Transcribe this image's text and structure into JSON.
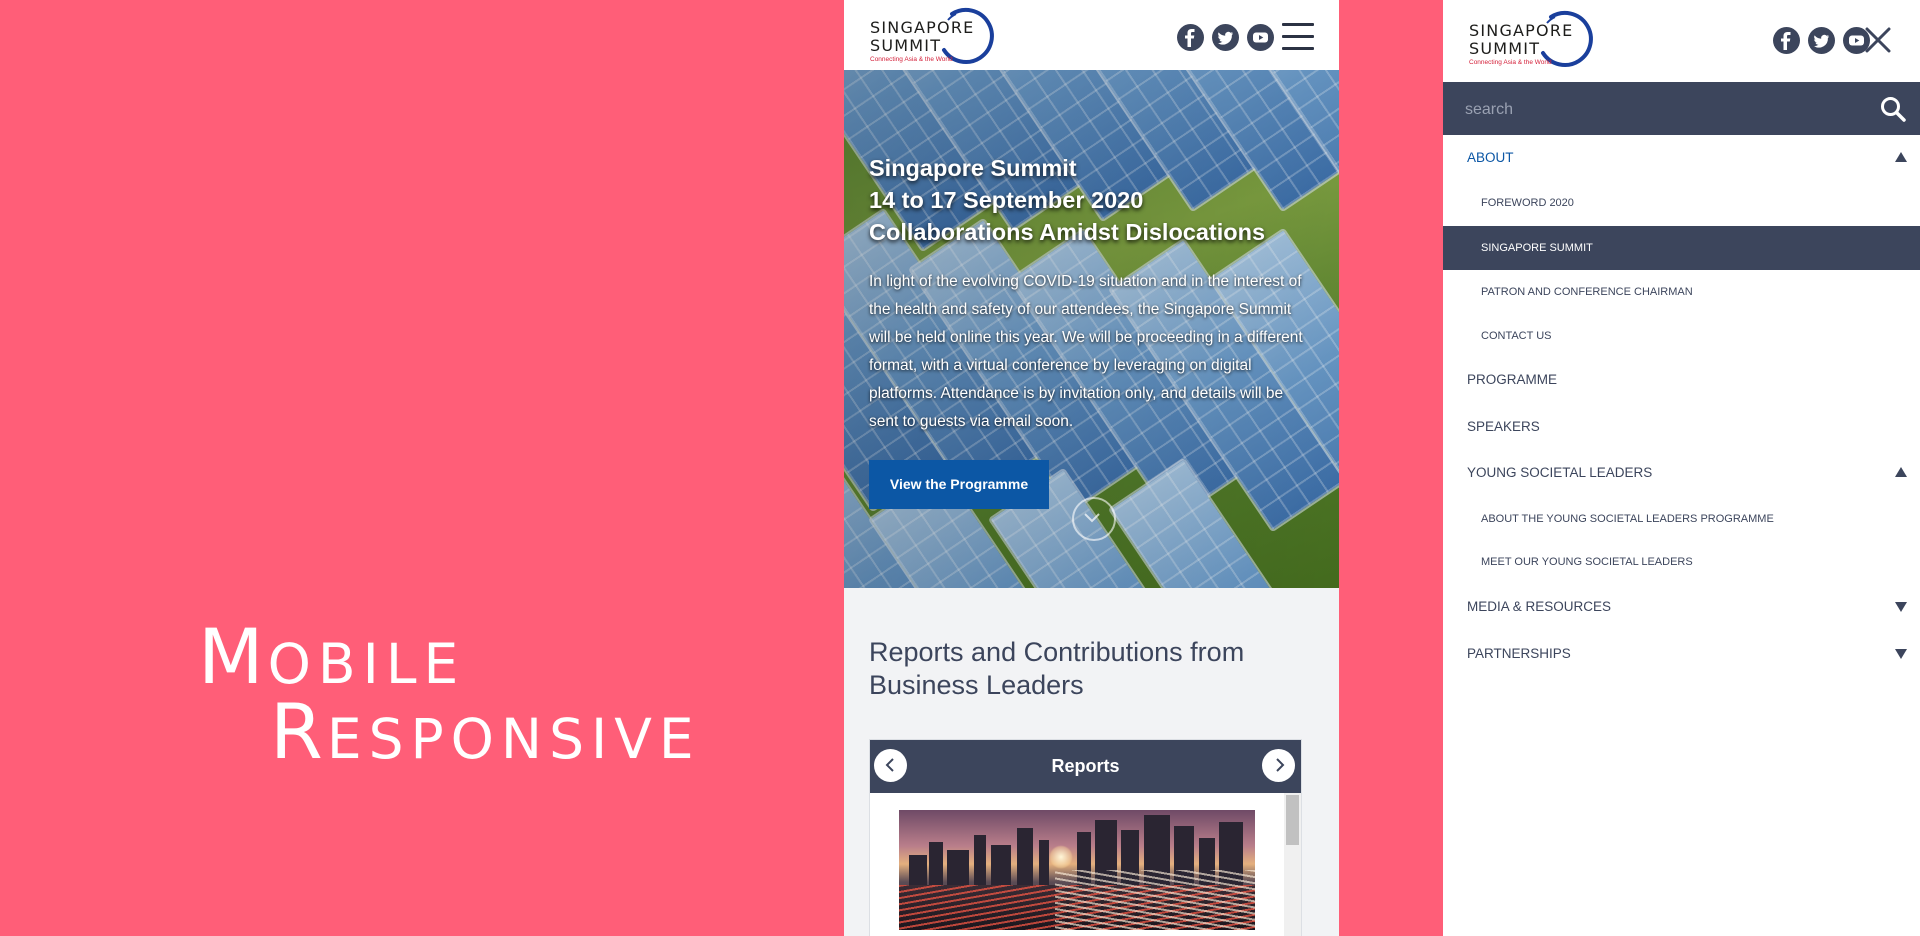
{
  "headline": {
    "word1_cap": "M",
    "word1_rest": "obile",
    "word2_cap": "R",
    "word2_rest": "esponsive"
  },
  "logo": {
    "line1": "SINGAPORE",
    "line2": "SUMMIT",
    "tagline": "Connecting Asia & the World"
  },
  "social": [
    {
      "icon": "facebook-icon"
    },
    {
      "icon": "twitter-icon"
    },
    {
      "icon": "youtube-icon"
    }
  ],
  "hero": {
    "title_lines": [
      "Singapore Summit",
      "14 to 17 September 2020",
      "Collaborations Amidst Dislocations"
    ],
    "body": "In light of the evolving COVID-19 situation and in the interest of the health and safety of our attendees, the Singapore Summit will be held online this year. We will be proceeding in a different format, with a virtual conference by leveraging on digital platforms. Attendance is by invitation only, and details will be sent to guests via email soon.",
    "button_label": "View the Programme"
  },
  "reports": {
    "heading": "Reports and Contributions from Business Leaders",
    "carousel_title": "Reports"
  },
  "menu": {
    "search_placeholder": "search",
    "items": [
      {
        "label": "ABOUT",
        "level": 0,
        "state": "open",
        "caret": "up"
      },
      {
        "label": "FOREWORD 2020",
        "level": 1
      },
      {
        "label": "SINGAPORE SUMMIT",
        "level": 1,
        "selected": true
      },
      {
        "label": "PATRON AND CONFERENCE CHAIRMAN",
        "level": 1
      },
      {
        "label": "CONTACT US",
        "level": 1
      },
      {
        "label": "PROGRAMME",
        "level": 0
      },
      {
        "label": "SPEAKERS",
        "level": 0
      },
      {
        "label": "YOUNG SOCIETAL LEADERS",
        "level": 0,
        "caret": "up"
      },
      {
        "label": "ABOUT THE YOUNG SOCIETAL LEADERS PROGRAMME",
        "level": 1
      },
      {
        "label": "MEET OUR YOUNG SOCIETAL LEADERS",
        "level": 1
      },
      {
        "label": "MEDIA & RESOURCES",
        "level": 0,
        "caret": "down"
      },
      {
        "label": "PARTNERSHIPS",
        "level": 0,
        "caret": "down"
      }
    ]
  },
  "colors": {
    "background": "#ff5e78",
    "navy": "#3c455c",
    "brand_blue": "#0c57a5",
    "logo_ring": "#1a3f9c",
    "tagline_red": "#d4213a"
  }
}
